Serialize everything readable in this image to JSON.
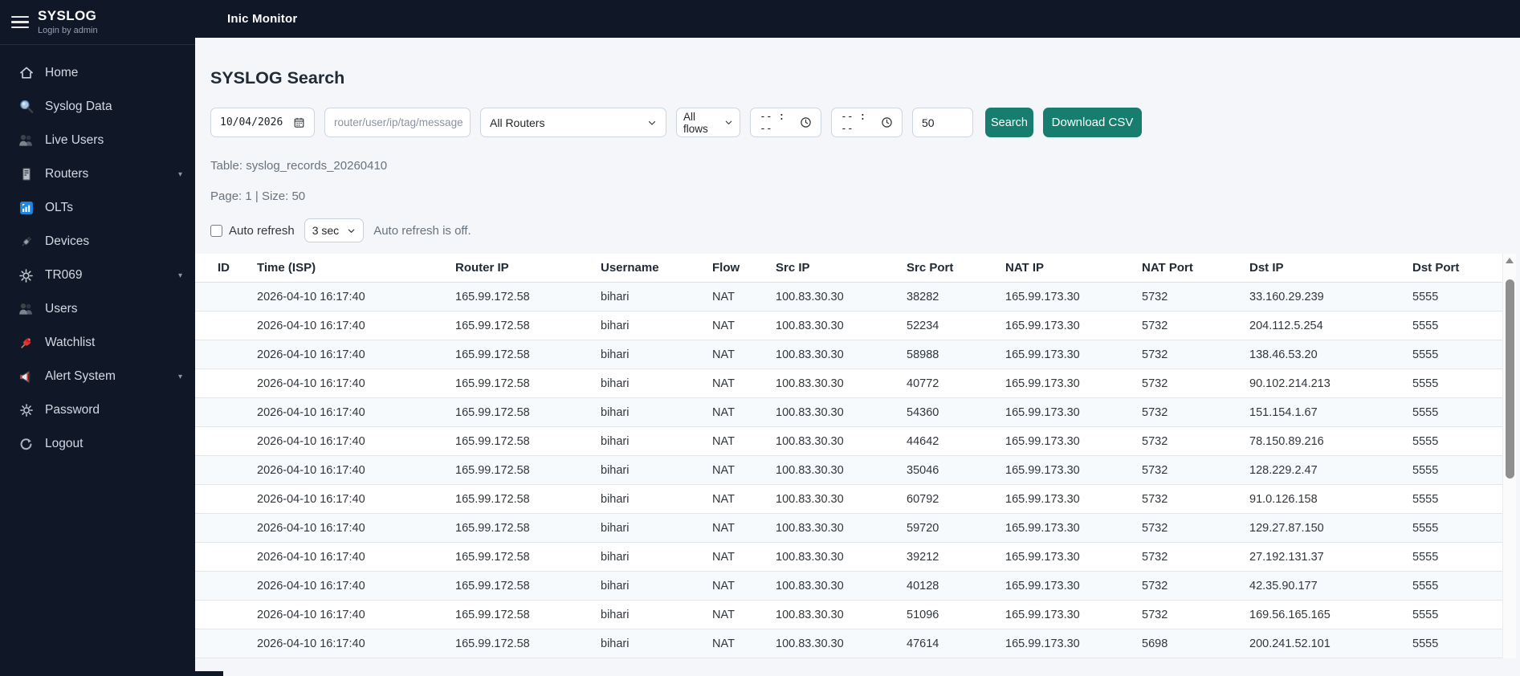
{
  "app": {
    "brand": "SYSLOG",
    "login_status": "Login by admin",
    "topbar_title": "Inic Monitor"
  },
  "sidebar": {
    "items": [
      {
        "label": "Home",
        "icon": "house-icon"
      },
      {
        "label": "Syslog Data",
        "icon": "search-icon"
      },
      {
        "label": "Live Users",
        "icon": "users-icon"
      },
      {
        "label": "Routers",
        "icon": "server-icon",
        "caret": "▾"
      },
      {
        "label": "OLTs",
        "icon": "signal-icon"
      },
      {
        "label": "Devices",
        "icon": "plug-icon"
      },
      {
        "label": "TR069",
        "icon": "gear-icon",
        "caret": "▾"
      },
      {
        "label": "Users",
        "icon": "users-icon"
      },
      {
        "label": "Watchlist",
        "icon": "pin-icon"
      },
      {
        "label": "Alert System",
        "icon": "megaphone-icon",
        "caret": "▾"
      },
      {
        "label": "Password",
        "icon": "gear-icon"
      },
      {
        "label": "Logout",
        "icon": "logout-icon"
      }
    ]
  },
  "search": {
    "title": "SYSLOG Search",
    "date_value": "10/04/2026",
    "query_placeholder": "router/user/ip/tag/message",
    "router_select_value": "All Routers",
    "flow_select_value": "All flows",
    "time_from_value": "-- : --",
    "time_to_value": "-- : --",
    "limit_value": "50",
    "search_label": "Search",
    "download_label": "Download CSV"
  },
  "meta": {
    "table_line": "Table: syslog_records_20260410",
    "page_line": "Page: 1 | Size: 50",
    "auto_refresh_label": "Auto refresh",
    "interval_value": "3 sec",
    "status_text": "Auto refresh is off."
  },
  "table": {
    "columns": [
      "ID",
      "Time (ISP)",
      "Router IP",
      "Username",
      "Flow",
      "Src IP",
      "Src Port",
      "NAT IP",
      "NAT Port",
      "Dst IP",
      "Dst Port"
    ],
    "rows": [
      [
        "",
        "2026-04-10 16:17:40",
        "165.99.172.58",
        "bihari",
        "NAT",
        "100.83.30.30",
        "38282",
        "165.99.173.30",
        "5732",
        "33.160.29.239",
        "5555"
      ],
      [
        "",
        "2026-04-10 16:17:40",
        "165.99.172.58",
        "bihari",
        "NAT",
        "100.83.30.30",
        "52234",
        "165.99.173.30",
        "5732",
        "204.112.5.254",
        "5555"
      ],
      [
        "",
        "2026-04-10 16:17:40",
        "165.99.172.58",
        "bihari",
        "NAT",
        "100.83.30.30",
        "58988",
        "165.99.173.30",
        "5732",
        "138.46.53.20",
        "5555"
      ],
      [
        "",
        "2026-04-10 16:17:40",
        "165.99.172.58",
        "bihari",
        "NAT",
        "100.83.30.30",
        "40772",
        "165.99.173.30",
        "5732",
        "90.102.214.213",
        "5555"
      ],
      [
        "",
        "2026-04-10 16:17:40",
        "165.99.172.58",
        "bihari",
        "NAT",
        "100.83.30.30",
        "54360",
        "165.99.173.30",
        "5732",
        "151.154.1.67",
        "5555"
      ],
      [
        "",
        "2026-04-10 16:17:40",
        "165.99.172.58",
        "bihari",
        "NAT",
        "100.83.30.30",
        "44642",
        "165.99.173.30",
        "5732",
        "78.150.89.216",
        "5555"
      ],
      [
        "",
        "2026-04-10 16:17:40",
        "165.99.172.58",
        "bihari",
        "NAT",
        "100.83.30.30",
        "35046",
        "165.99.173.30",
        "5732",
        "128.229.2.47",
        "5555"
      ],
      [
        "",
        "2026-04-10 16:17:40",
        "165.99.172.58",
        "bihari",
        "NAT",
        "100.83.30.30",
        "60792",
        "165.99.173.30",
        "5732",
        "91.0.126.158",
        "5555"
      ],
      [
        "",
        "2026-04-10 16:17:40",
        "165.99.172.58",
        "bihari",
        "NAT",
        "100.83.30.30",
        "59720",
        "165.99.173.30",
        "5732",
        "129.27.87.150",
        "5555"
      ],
      [
        "",
        "2026-04-10 16:17:40",
        "165.99.172.58",
        "bihari",
        "NAT",
        "100.83.30.30",
        "39212",
        "165.99.173.30",
        "5732",
        "27.192.131.37",
        "5555"
      ],
      [
        "",
        "2026-04-10 16:17:40",
        "165.99.172.58",
        "bihari",
        "NAT",
        "100.83.30.30",
        "40128",
        "165.99.173.30",
        "5732",
        "42.35.90.177",
        "5555"
      ],
      [
        "",
        "2026-04-10 16:17:40",
        "165.99.172.58",
        "bihari",
        "NAT",
        "100.83.30.30",
        "51096",
        "165.99.173.30",
        "5732",
        "169.56.165.165",
        "5555"
      ],
      [
        "",
        "2026-04-10 16:17:40",
        "165.99.172.58",
        "bihari",
        "NAT",
        "100.83.30.30",
        "47614",
        "165.99.173.30",
        "5698",
        "200.241.52.101",
        "5555"
      ]
    ]
  },
  "colors": {
    "sidebar_bg": "#101828",
    "topbar_bg": "#101828",
    "accent_teal": "#177e6f",
    "content_bg": "#f4f6f9",
    "olt_icon_blue": "#1e88e5",
    "pin_red": "#e3342f"
  }
}
